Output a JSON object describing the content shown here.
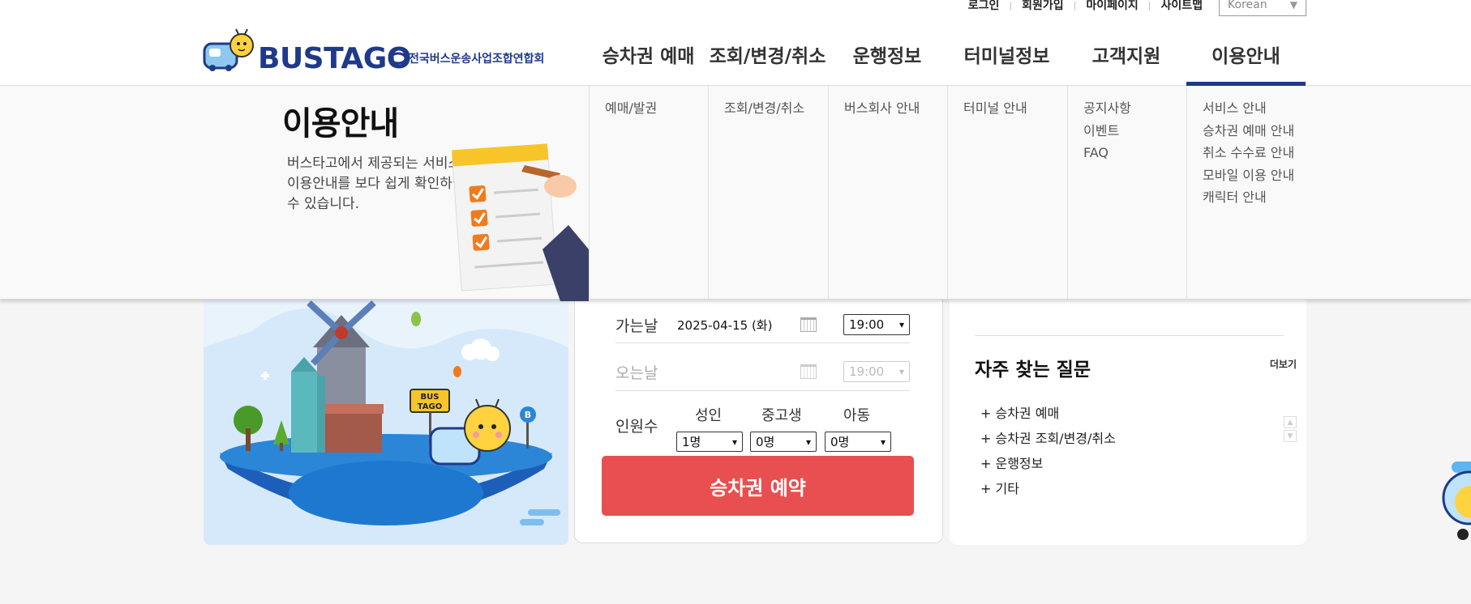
{
  "util": {
    "login": "로그인",
    "signup": "회원가입",
    "mypage": "마이페이지",
    "sitemap": "사이트맵",
    "language": "Korean"
  },
  "logo": {
    "wordmark": "BUSTAGO",
    "sub": "전국버스운송사업조합연합회"
  },
  "gnb": [
    {
      "label": "승차권 예매"
    },
    {
      "label": "조회/변경/취소"
    },
    {
      "label": "운행정보"
    },
    {
      "label": "터미널정보"
    },
    {
      "label": "고객지원"
    },
    {
      "label": "이용안내"
    }
  ],
  "mega": {
    "title": "이용안내",
    "desc": "버스타고에서 제공되는 서비스 및 이용안내를 보다 쉽게 확인하실 수 있습니다.",
    "cols": [
      {
        "items": [
          "예매/발권"
        ]
      },
      {
        "items": [
          "조회/변경/취소"
        ]
      },
      {
        "items": [
          "버스회사 안내"
        ]
      },
      {
        "items": [
          "터미널 안내"
        ]
      },
      {
        "items": [
          "공지사항",
          "이벤트",
          "FAQ"
        ]
      },
      {
        "items": [
          "서비스 안내",
          "승차권 예매 안내",
          "취소 수수료 안내",
          "모바일 이용 안내",
          "캐릭터 안내"
        ]
      }
    ]
  },
  "hero": {
    "sign": "BUS TAGO",
    "stop_letter": "B"
  },
  "booking": {
    "depart_label": "가는날",
    "depart_date": "2025-04-15 (화)",
    "depart_time": "19:00",
    "return_label": "오는날",
    "return_time": "19:00",
    "pax_label": "인원수",
    "adult_label": "성인",
    "adult_value": "1명",
    "teen_label": "중고생",
    "teen_value": "0명",
    "child_label": "아동",
    "child_value": "0명",
    "submit": "승차권 예약"
  },
  "faq": {
    "title": "자주 찾는 질문",
    "more": "더보기",
    "items": [
      "+ 승차권 예매",
      "+ 승차권 조회/변경/취소",
      "+ 운행정보",
      "+ 기타"
    ]
  },
  "colors": {
    "brand": "#1e3a8a",
    "cta": "#e84f51",
    "hero_bg": "#d6e9fb"
  }
}
